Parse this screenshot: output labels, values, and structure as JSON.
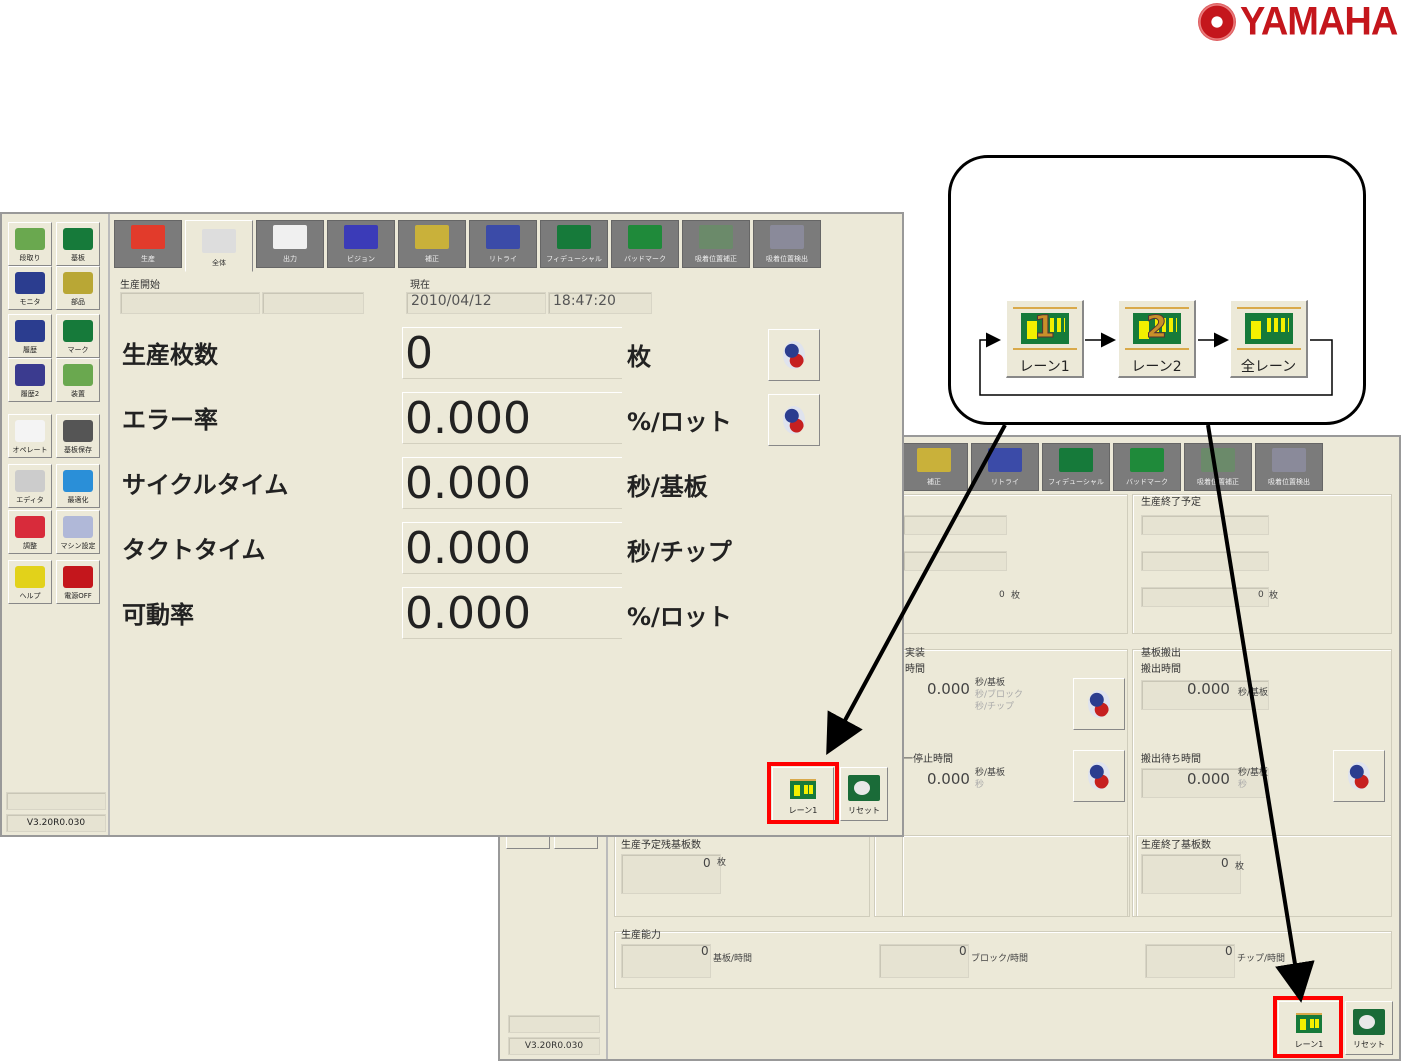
{
  "brand": {
    "logo_text": "YAMAHA"
  },
  "sidebar": {
    "items": [
      {
        "label": "段取り",
        "color": "#6aa84f"
      },
      {
        "label": "基板",
        "color": "#167a3a"
      },
      {
        "label": "モニタ",
        "color": "#2b3d8f"
      },
      {
        "label": "部品",
        "color": "#b9a735"
      },
      {
        "label": "履歴",
        "color": "#2b3d8f"
      },
      {
        "label": "マーク",
        "color": "#167a3a"
      },
      {
        "label": "履歴2",
        "color": "#3b3b8f"
      },
      {
        "label": "装置",
        "color": "#6aa84f"
      },
      {
        "label": "オペレート",
        "color": "#f4f4f4"
      },
      {
        "label": "基板保存",
        "color": "#555555"
      },
      {
        "label": "エディタ",
        "color": "#cccccc"
      },
      {
        "label": "最適化",
        "color": "#2a8fd8"
      },
      {
        "label": "調整",
        "color": "#d82b3b"
      },
      {
        "label": "マシン設定",
        "color": "#b0b8d8"
      },
      {
        "label": "ヘルプ",
        "color": "#e2d21a"
      },
      {
        "label": "電源OFF",
        "color": "#c4161c"
      }
    ],
    "version": "V3.20R0.030"
  },
  "tabs": [
    {
      "label": "生産",
      "color": "#e23b2b"
    },
    {
      "label": "全体",
      "color": "#dddddd"
    },
    {
      "label": "出力",
      "color": "#f0f0f0"
    },
    {
      "label": "ビジョン",
      "color": "#3b3bb8"
    },
    {
      "label": "補正",
      "color": "#c9b13a"
    },
    {
      "label": "リトライ",
      "color": "#3b4ba8"
    },
    {
      "label": "フィデューシャル",
      "color": "#167a3a"
    },
    {
      "label": "バッドマーク",
      "color": "#1f8a3a"
    },
    {
      "label": "吸着位置補正",
      "color": "#6b8a6a"
    },
    {
      "label": "吸着位置検出",
      "color": "#8a8a9a"
    }
  ],
  "front": {
    "start_label": "生産開始",
    "now_label": "現在",
    "date": "2010/04/12",
    "time": "18:47:20",
    "rows": [
      {
        "label": "生産枚数",
        "value": "0",
        "unit": "枚"
      },
      {
        "label": "エラー率",
        "value": "0.000",
        "unit": "%/ロット"
      },
      {
        "label": "サイクルタイム",
        "value": "0.000",
        "unit": "秒/基板"
      },
      {
        "label": "タクトタイム",
        "value": "0.000",
        "unit": "秒/チップ"
      },
      {
        "label": "可動率",
        "value": "0.000",
        "unit": "%/ロット"
      }
    ],
    "lane_button": "レーン1",
    "reset_button": "リセット"
  },
  "back": {
    "scheduled_end": "生産終了予定",
    "count_a": "0",
    "count_b": "0",
    "unit_sheet": "枚",
    "mount": {
      "title": "実装",
      "time_label": "時間",
      "value": "0.000",
      "units": [
        "秒/基板",
        "秒/ブロック",
        "秒/チップ"
      ],
      "stop_label": "一停止時間",
      "stop_value": "0.000",
      "stop_units": [
        "秒/基板",
        "秒"
      ]
    },
    "unload": {
      "title": "基板搬出",
      "time_label": "搬出時間",
      "value": "0.000",
      "unit": "秒/基板",
      "wait_label": "搬出待ち時間",
      "wait_value": "0.000",
      "wait_units": [
        "秒/基板",
        "秒"
      ]
    },
    "remaining": {
      "label": "生産予定残基板数",
      "value": "0",
      "unit": "枚"
    },
    "finished": {
      "label": "生産終了基板数",
      "value": "0",
      "unit": "枚"
    },
    "capacity": {
      "label": "生産能力",
      "items": [
        {
          "value": "0",
          "unit": "基板/時間"
        },
        {
          "value": "0",
          "unit": "ブロック/時間"
        },
        {
          "value": "0",
          "unit": "チップ/時間"
        }
      ]
    },
    "lane_button": "レーン1",
    "reset_button": "リセット",
    "version": "V3.20R0.030"
  },
  "callout": {
    "buttons": [
      {
        "label": "レーン1",
        "num": "1"
      },
      {
        "label": "レーン2",
        "num": "2"
      },
      {
        "label": "全レーン",
        "num": ""
      }
    ]
  }
}
